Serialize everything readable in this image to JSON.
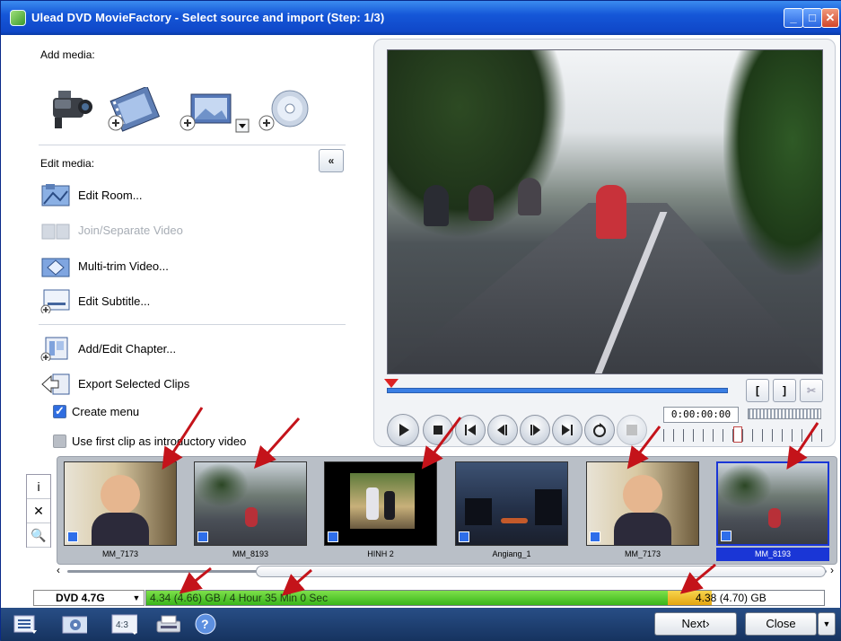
{
  "window": {
    "title": "Ulead DVD MovieFactory - Select source and import (Step: 1/3)",
    "controls": {
      "minimize": "_",
      "maximize": "□",
      "close": "✕"
    }
  },
  "add_media": {
    "label": "Add media:",
    "sources": [
      "camcorder-icon",
      "video-file-icon",
      "image-file-icon",
      "disc-icon"
    ]
  },
  "edit_media": {
    "label": "Edit media:",
    "collapse": "«",
    "items": [
      {
        "label": "Edit Room...",
        "enabled": true
      },
      {
        "label": "Join/Separate Video",
        "enabled": false
      },
      {
        "label": "Multi-trim Video...",
        "enabled": true
      },
      {
        "label": "Edit Subtitle...",
        "enabled": true
      }
    ],
    "chapter_items": [
      {
        "label": "Add/Edit Chapter..."
      },
      {
        "label": "Export Selected Clips"
      }
    ]
  },
  "options": {
    "create_menu": {
      "label": "Create menu",
      "checked": true
    },
    "intro_clip": {
      "label": "Use first clip as introductory video",
      "checked": false
    }
  },
  "player": {
    "timecode": "0:00:00:00",
    "mark_in": "[",
    "mark_out": "]",
    "cut": "✂",
    "progress": 0.0
  },
  "side_tools": [
    "i",
    "✕",
    "🔍"
  ],
  "clips": [
    {
      "name": "MM_7173",
      "selected": false,
      "kind": "kid"
    },
    {
      "name": "MM_8193",
      "selected": false,
      "kind": "road"
    },
    {
      "name": "HINH 2",
      "selected": false,
      "kind": "photo"
    },
    {
      "name": "Angiang_1",
      "selected": false,
      "kind": "night"
    },
    {
      "name": "MM_7173",
      "selected": false,
      "kind": "kid"
    },
    {
      "name": "MM_8193",
      "selected": true,
      "kind": "road"
    }
  ],
  "disc": {
    "type": "DVD 4.7G",
    "usage_text": "4.34 (4.66) GB / 4 Hour 35 Min 0 Sec",
    "capacity_text": "4.38 (4.70) GB",
    "used_fraction": 0.77,
    "warn_fraction": 0.065
  },
  "footer": {
    "next": "Next›",
    "close": "Close",
    "icons": [
      "list-icon",
      "settings-icon",
      "aspect-ratio-icon",
      "printer-icon",
      "help-icon"
    ]
  },
  "colors": {
    "title_bar": "#0f47c8",
    "selection": "#1a36d6",
    "capacity_green": "#39b51a",
    "capacity_warn": "#e3a411",
    "annotation_arrow": "#c4131a"
  }
}
